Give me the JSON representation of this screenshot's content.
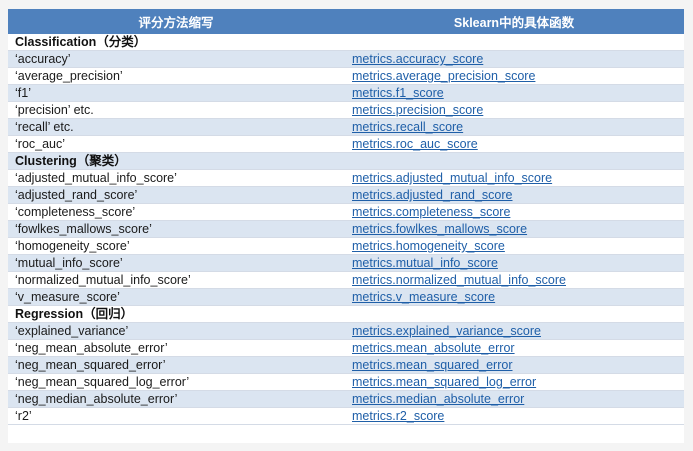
{
  "header": {
    "col1": "评分方法缩写",
    "col2": "Sklearn中的具体函数"
  },
  "rows": [
    {
      "type": "group",
      "label": "Classification（分类）"
    },
    {
      "type": "row",
      "name": "‘accuracy’",
      "fn": "metrics.accuracy_score"
    },
    {
      "type": "row",
      "name": "‘average_precision’",
      "fn": "metrics.average_precision_score"
    },
    {
      "type": "row",
      "name": "‘f1’",
      "fn": "metrics.f1_score"
    },
    {
      "type": "row",
      "name": "‘precision’ etc.",
      "fn": "metrics.precision_score"
    },
    {
      "type": "row",
      "name": "‘recall’ etc.",
      "fn": "metrics.recall_score"
    },
    {
      "type": "row",
      "name": "‘roc_auc’",
      "fn": "metrics.roc_auc_score"
    },
    {
      "type": "group",
      "label": "Clustering（聚类）"
    },
    {
      "type": "row",
      "name": "‘adjusted_mutual_info_score’",
      "fn": "metrics.adjusted_mutual_info_score"
    },
    {
      "type": "row",
      "name": "‘adjusted_rand_score’",
      "fn": "metrics.adjusted_rand_score"
    },
    {
      "type": "row",
      "name": "‘completeness_score’",
      "fn": "metrics.completeness_score"
    },
    {
      "type": "row",
      "name": "‘fowlkes_mallows_score’",
      "fn": "metrics.fowlkes_mallows_score"
    },
    {
      "type": "row",
      "name": "‘homogeneity_score’",
      "fn": "metrics.homogeneity_score"
    },
    {
      "type": "row",
      "name": "‘mutual_info_score’",
      "fn": "metrics.mutual_info_score"
    },
    {
      "type": "row",
      "name": "‘normalized_mutual_info_score’",
      "fn": "metrics.normalized_mutual_info_score"
    },
    {
      "type": "row",
      "name": "‘v_measure_score’",
      "fn": "metrics.v_measure_score"
    },
    {
      "type": "group",
      "label": "Regression（回归）"
    },
    {
      "type": "row",
      "name": "‘explained_variance’",
      "fn": "metrics.explained_variance_score"
    },
    {
      "type": "row",
      "name": "‘neg_mean_absolute_error’",
      "fn": "metrics.mean_absolute_error"
    },
    {
      "type": "row",
      "name": "‘neg_mean_squared_error’",
      "fn": "metrics.mean_squared_error"
    },
    {
      "type": "row",
      "name": "‘neg_mean_squared_log_error’",
      "fn": "metrics.mean_squared_log_error"
    },
    {
      "type": "row",
      "name": "‘neg_median_absolute_error’",
      "fn": "metrics.median_absolute_error"
    },
    {
      "type": "row",
      "name": "‘r2’",
      "fn": "metrics.r2_score"
    }
  ],
  "colors": {
    "header_bg": "#4f81bd",
    "stripe_bg": "#dbe5f1",
    "link": "#1f5fa8"
  }
}
